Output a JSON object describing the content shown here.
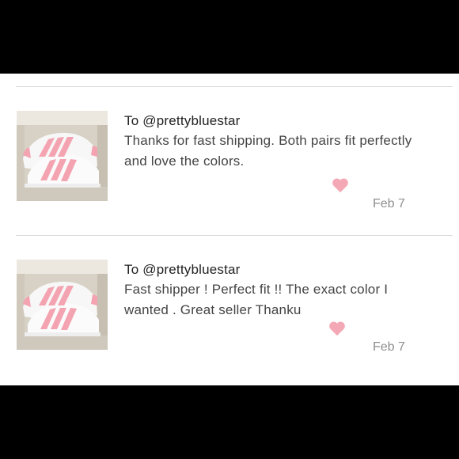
{
  "reviews": [
    {
      "to": "To @prettybluestar",
      "text_line1": "Thanks for fast shipping. Both pairs fit perfectly",
      "text_line2": "and love the colors.",
      "date": "Feb 7",
      "heart_color": "#f4a7b5"
    },
    {
      "to": "To @prettybluestar",
      "text_line1": "Fast shipper ! Perfect fit !! The exact color I",
      "text_line2": "wanted . Great seller Thanku",
      "date": "Feb 7",
      "heart_color": "#f4a7b5"
    }
  ],
  "colors": {
    "background": "#000000",
    "panel": "#ffffff",
    "stripe_pink": "#f4a3b1"
  }
}
